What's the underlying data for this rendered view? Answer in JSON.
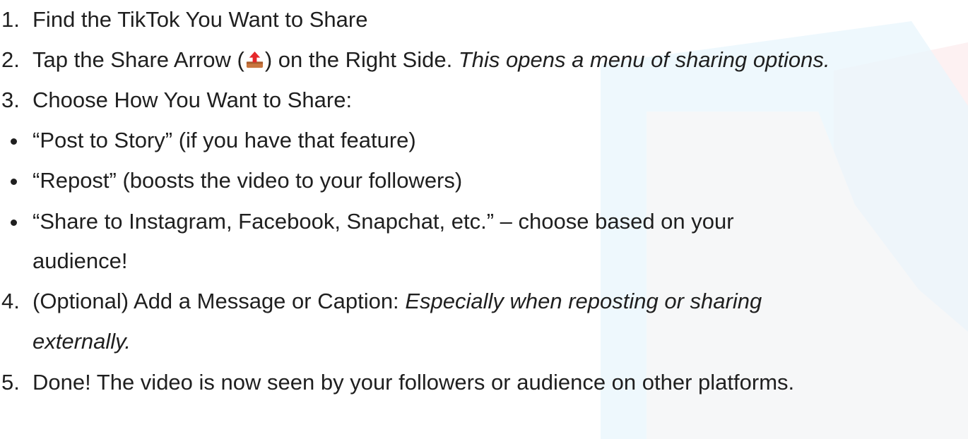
{
  "steps": [
    {
      "num": "1.",
      "text": "Find the TikTok You Want to Share"
    },
    {
      "num": "2.",
      "text_before": "Tap the Share Arrow (",
      "icon": "share-arrow-icon",
      "text_after": ") on the Right Side.",
      "italic": "This opens a menu of sharing options."
    },
    {
      "num": "3.",
      "text": "Choose How You Want to Share:"
    },
    {
      "num": "4.",
      "text": "(Optional) Add a Message or Caption:",
      "italic_line1": "Especially when reposting or sharing",
      "italic_line2": "externally."
    },
    {
      "num": "5.",
      "text": "Done! The video is now seen by your followers or audience on other platforms."
    }
  ],
  "bullets": [
    {
      "text": "“Post to Story” (if you have that feature)"
    },
    {
      "text": "“Repost” (boosts the video to your followers)"
    },
    {
      "text_line1": "“Share to Instagram, Facebook, Snapchat, etc.” – choose based on your",
      "text_line2": "audience!"
    }
  ],
  "colors": {
    "text": "#1f1f1f",
    "share_icon_base": "#c9763f",
    "share_icon_arrow": "#e5282b",
    "decor_blue": "#e9f6fd",
    "decor_red": "#fdeaea"
  }
}
